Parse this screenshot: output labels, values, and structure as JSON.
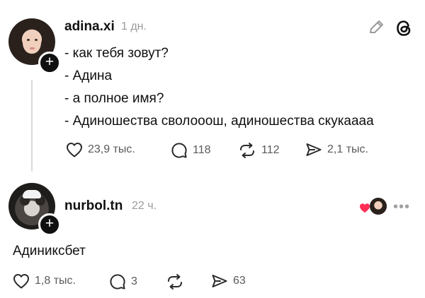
{
  "post": {
    "username": "adina.xi",
    "time": "1 дн.",
    "lines": [
      "- как тебя зовут?",
      "- Адина",
      "- а полное имя?",
      "- Адиношества сволооош, адиношества скукаааа"
    ],
    "likes": "23,9 тыс.",
    "replies": "118",
    "reposts": "112",
    "shares": "2,1 тыс."
  },
  "reply": {
    "username": "nurbol.tn",
    "time": "22 ч.",
    "text": "Адиниксбет",
    "likes": "1,8 тыс.",
    "replies": "3",
    "reposts": "",
    "shares": "63"
  },
  "icons": {
    "edit": "pencil-icon",
    "logo": "threads-logo",
    "more": "more-dots-icon",
    "like": "heart-icon",
    "reply": "comment-icon",
    "repost": "repost-icon",
    "share": "send-icon",
    "follow": "plus-icon"
  },
  "colors": {
    "text": "#101010",
    "muted": "#9a9a9a",
    "heart": "#ff2d55"
  }
}
